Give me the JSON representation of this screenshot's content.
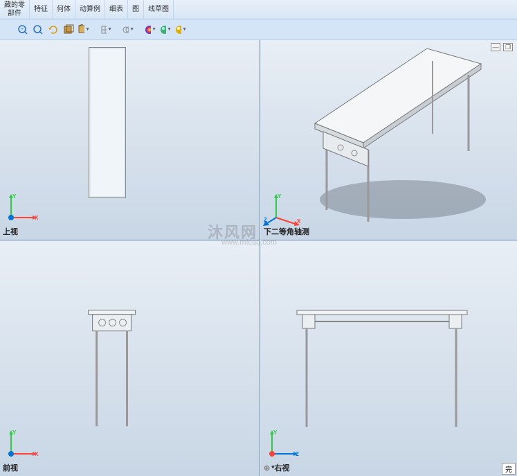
{
  "ribbon": {
    "items": [
      {
        "line1": "藏的零",
        "line2": "部件"
      },
      {
        "line1": "特征",
        "line2": ""
      },
      {
        "line1": "何体",
        "line2": ""
      },
      {
        "line1": "动算例",
        "line2": ""
      },
      {
        "line1": "细表",
        "line2": ""
      },
      {
        "line1": "图",
        "line2": ""
      },
      {
        "line1": "线草图",
        "line2": ""
      }
    ]
  },
  "toolbar": {
    "icons": [
      {
        "name": "zoom-window-icon",
        "glyph": "🔍"
      },
      {
        "name": "zoom-fit-icon",
        "glyph": "🔍"
      },
      {
        "name": "rotate-icon",
        "glyph": "↻"
      },
      {
        "name": "section-icon",
        "glyph": "▦"
      },
      {
        "name": "display-style-icon",
        "glyph": "▢"
      },
      {
        "name": "hide-show-icon",
        "glyph": "◫"
      },
      {
        "name": "edit-appearance-icon",
        "glyph": "⬡"
      },
      {
        "name": "apply-scene-icon",
        "glyph": "●"
      },
      {
        "name": "view-settings-icon",
        "glyph": "●"
      },
      {
        "name": "view-orientation-icon",
        "glyph": "●"
      }
    ]
  },
  "views": {
    "tl": {
      "label": "上视"
    },
    "tr": {
      "label": "下二等角轴测"
    },
    "bl": {
      "label": "前视"
    },
    "br": {
      "label": "*右视",
      "link_glyph": "⊕"
    }
  },
  "axes": {
    "x": "X",
    "y": "Y",
    "z": "Z"
  },
  "watermark": {
    "text": "沐风网",
    "url": "www.mfcad.com"
  },
  "window_controls": {
    "minimize": "—",
    "restore": "❐"
  },
  "status": {
    "text": "完"
  }
}
